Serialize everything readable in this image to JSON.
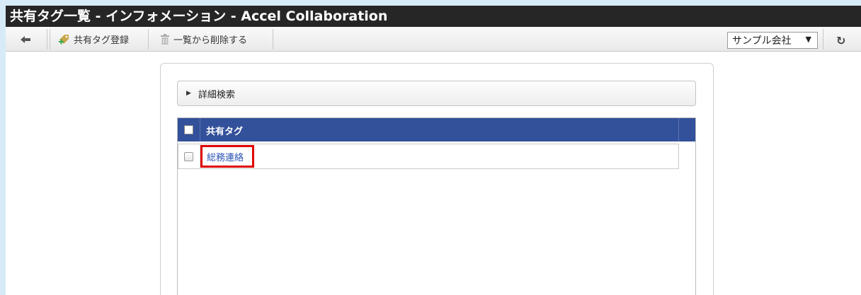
{
  "window": {
    "title": "共有タグ一覧 - インフォメーション - Accel Collaboration"
  },
  "toolbar": {
    "back_icon": "back-arrow-icon",
    "register_label": "共有タグ登録",
    "register_icon": "tag-add-icon",
    "delete_label": "一覧から削除する",
    "delete_icon": "trash-icon",
    "company_select": "サンプル会社",
    "refresh_icon": "refresh-icon"
  },
  "search": {
    "label": "詳細検索"
  },
  "table": {
    "header": "共有タグ",
    "rows": [
      {
        "name": "総務連絡"
      }
    ]
  },
  "colors": {
    "header_bg": "#33509a",
    "title_bg": "#262626",
    "link": "#2952b3",
    "highlight": "#e00000",
    "page_bg": "#d6ebf7"
  }
}
